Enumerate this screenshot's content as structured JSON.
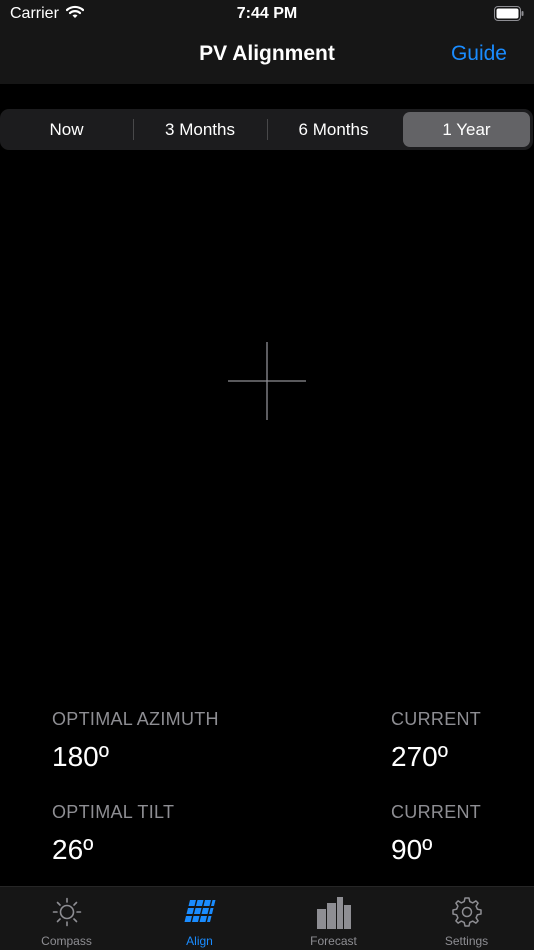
{
  "status_bar": {
    "carrier": "Carrier",
    "time": "7:44 PM"
  },
  "nav": {
    "title": "PV Alignment",
    "guide_label": "Guide"
  },
  "segments": {
    "items": [
      "Now",
      "3 Months",
      "6 Months",
      "1 Year"
    ],
    "selected": "1 Year"
  },
  "readings": {
    "optimal_azimuth": {
      "label": "OPTIMAL AZIMUTH",
      "value": "180º"
    },
    "current_azimuth": {
      "label": "CURRENT",
      "value": "270º"
    },
    "optimal_tilt": {
      "label": "OPTIMAL TILT",
      "value": "26º"
    },
    "current_tilt": {
      "label": "CURRENT",
      "value": "90º"
    }
  },
  "tabs": [
    {
      "label": "Compass",
      "icon": "sun-icon"
    },
    {
      "label": "Align",
      "icon": "solar-panel-icon"
    },
    {
      "label": "Forecast",
      "icon": "bar-chart-icon"
    },
    {
      "label": "Settings",
      "icon": "gear-icon"
    }
  ],
  "selected_tab": "Align",
  "colors": {
    "accent": "#1a8cff",
    "secondary_text": "#8e8e93",
    "selected_segment": "#636366"
  }
}
